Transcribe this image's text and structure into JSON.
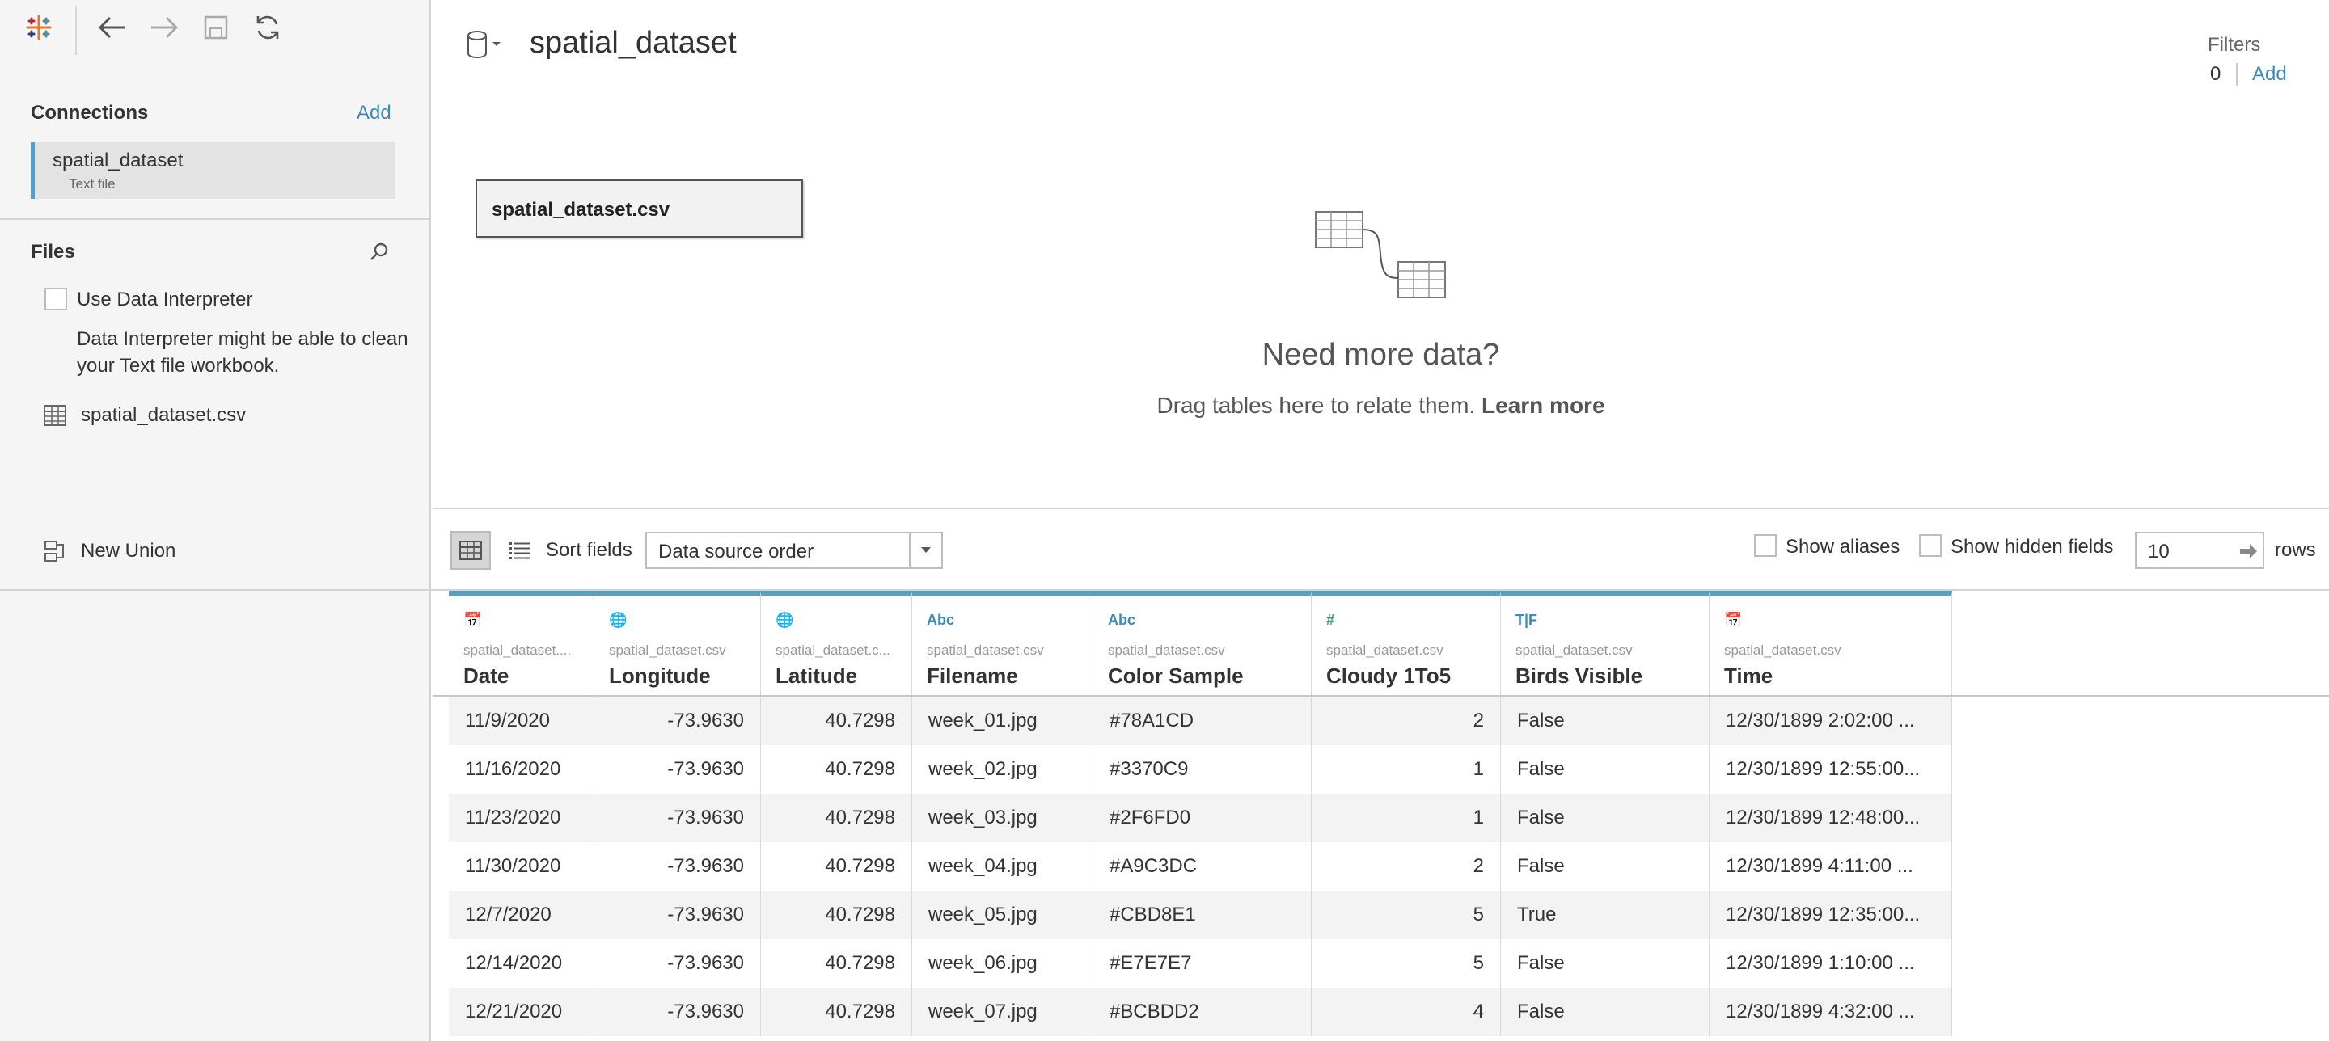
{
  "toolbar": {
    "logo_icon": "tableau-logo-icon",
    "back_icon": "back-arrow-icon",
    "forward_icon": "forward-arrow-icon",
    "save_icon": "save-icon",
    "refresh_icon": "refresh-icon"
  },
  "sidebar": {
    "connections_heading": "Connections",
    "connections_add": "Add",
    "connection": {
      "name": "spatial_dataset",
      "type": "Text file"
    },
    "files_heading": "Files",
    "use_data_interpreter": "Use Data Interpreter",
    "data_interpreter_desc": "Data Interpreter might be able to clean your Text file workbook.",
    "file_name": "spatial_dataset.csv",
    "new_union": "New Union"
  },
  "canvas": {
    "datasource_title": "spatial_dataset",
    "filters_label": "Filters",
    "filters_count": "0",
    "filters_add": "Add",
    "table_tile": "spatial_dataset.csv",
    "need_more": "Need more data?",
    "drag_text": "Drag tables here to relate them.",
    "learn_more": "Learn more"
  },
  "grid_toolbar": {
    "sort_label": "Sort fields",
    "sort_value": "Data source order",
    "show_aliases": "Show aliases",
    "show_hidden": "Show hidden fields",
    "rows_value": "10",
    "rows_label": "rows"
  },
  "grid": {
    "columns": [
      {
        "type": "📅",
        "type_color": "#3d8ab8",
        "source": "spatial_dataset....",
        "name": "Date",
        "align": "left"
      },
      {
        "type": "🌐",
        "type_color": "#2f9e6e",
        "source": "spatial_dataset.csv",
        "name": "Longitude",
        "align": "right"
      },
      {
        "type": "🌐",
        "type_color": "#2f9e6e",
        "source": "spatial_dataset.c...",
        "name": "Latitude",
        "align": "right"
      },
      {
        "type": "Abc",
        "type_color": "#3d8ab8",
        "source": "spatial_dataset.csv",
        "name": "Filename",
        "align": "left"
      },
      {
        "type": "Abc",
        "type_color": "#3d8ab8",
        "source": "spatial_dataset.csv",
        "name": "Color Sample",
        "align": "left"
      },
      {
        "type": "#",
        "type_color": "#2f9e6e",
        "source": "spatial_dataset.csv",
        "name": "Cloudy 1To5",
        "align": "right"
      },
      {
        "type": "T|F",
        "type_color": "#3d8ab8",
        "source": "spatial_dataset.csv",
        "name": "Birds Visible",
        "align": "left"
      },
      {
        "type": "📅",
        "type_color": "#3d8ab8",
        "source": "spatial_dataset.csv",
        "name": "Time",
        "align": "left"
      }
    ],
    "rows": [
      [
        "11/9/2020",
        "-73.9630",
        "40.7298",
        "week_01.jpg",
        "#78A1CD",
        "2",
        "False",
        "12/30/1899 2:02:00 ..."
      ],
      [
        "11/16/2020",
        "-73.9630",
        "40.7298",
        "week_02.jpg",
        "#3370C9",
        "1",
        "False",
        "12/30/1899 12:55:00..."
      ],
      [
        "11/23/2020",
        "-73.9630",
        "40.7298",
        "week_03.jpg",
        "#2F6FD0",
        "1",
        "False",
        "12/30/1899 12:48:00..."
      ],
      [
        "11/30/2020",
        "-73.9630",
        "40.7298",
        "week_04.jpg",
        "#A9C3DC",
        "2",
        "False",
        "12/30/1899 4:11:00 ..."
      ],
      [
        "12/7/2020",
        "-73.9630",
        "40.7298",
        "week_05.jpg",
        "#CBD8E1",
        "5",
        "True",
        "12/30/1899 12:35:00..."
      ],
      [
        "12/14/2020",
        "-73.9630",
        "40.7298",
        "week_06.jpg",
        "#E7E7E7",
        "5",
        "False",
        "12/30/1899 1:10:00 ..."
      ],
      [
        "12/21/2020",
        "-73.9630",
        "40.7298",
        "week_07.jpg",
        "#BCBDD2",
        "4",
        "False",
        "12/30/1899 4:32:00 ..."
      ]
    ]
  },
  "colors": {
    "accent": "#3d8ab8",
    "selection_bar": "#5a9ec7",
    "header_bar": "#5aa0c2"
  }
}
